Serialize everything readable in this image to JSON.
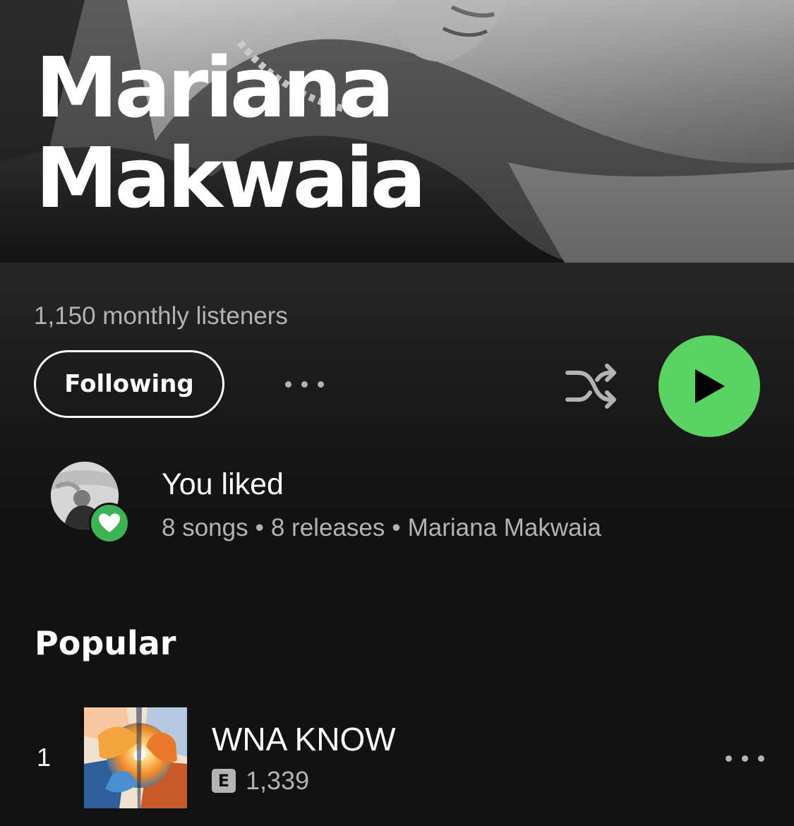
{
  "artist": {
    "name_line1": "Mariana",
    "name_line2": "Makwaia",
    "monthly_listeners": "1,150 monthly listeners"
  },
  "actions": {
    "follow_label": "Following",
    "more_icon": "more-horizontal-icon",
    "shuffle_icon": "shuffle-icon",
    "play_icon": "play-icon",
    "play_color": "#5ad264"
  },
  "liked": {
    "title": "You liked",
    "songs": "8 songs",
    "releases": "8 releases",
    "artist": "Mariana Makwaia",
    "separator": "•",
    "heart_icon": "heart-icon",
    "heart_color": "#3db354"
  },
  "popular": {
    "title": "Popular",
    "tracks": [
      {
        "rank": "1",
        "title": "WNA KNOW",
        "explicit": "E",
        "plays": "1,339"
      }
    ]
  }
}
